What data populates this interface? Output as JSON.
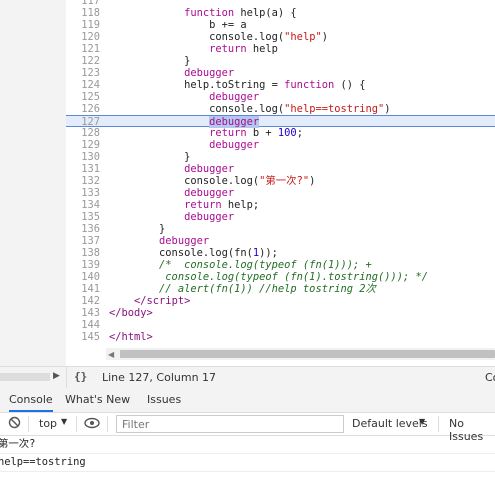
{
  "editor": {
    "lines": [
      {
        "n": "117",
        "h": ""
      },
      {
        "n": "118",
        "h": "            <span class=\"kw\">function</span> help(a) {"
      },
      {
        "n": "119",
        "h": "                b += a"
      },
      {
        "n": "120",
        "h": "                console.log(<span class=\"str\">\"help\"</span>)"
      },
      {
        "n": "121",
        "h": "                <span class=\"kw\">return</span> help"
      },
      {
        "n": "122",
        "h": "            }"
      },
      {
        "n": "123",
        "h": "            <span class=\"kw\">debugger</span>"
      },
      {
        "n": "124",
        "h": "            help.toString = <span class=\"kw\">function</span> () {"
      },
      {
        "n": "125",
        "h": "                <span class=\"kw\">debugger</span>"
      },
      {
        "n": "126",
        "h": "                console.log(<span class=\"str\">\"help==tostring\"</span>)"
      },
      {
        "n": "127",
        "h": "                <span class=\"kw sel\">debugger</span>",
        "active": true
      },
      {
        "n": "128",
        "h": "                <span class=\"kw\">return</span> b + <span class=\"num\">100</span>;"
      },
      {
        "n": "129",
        "h": "                <span class=\"kw\">debugger</span>"
      },
      {
        "n": "130",
        "h": "            }"
      },
      {
        "n": "131",
        "h": "            <span class=\"kw\">debugger</span>"
      },
      {
        "n": "132",
        "h": "            console.log(<span class=\"str\">\"第一次?\"</span>)"
      },
      {
        "n": "133",
        "h": "            <span class=\"kw\">debugger</span>"
      },
      {
        "n": "134",
        "h": "            <span class=\"kw\">return</span> help;"
      },
      {
        "n": "135",
        "h": "            <span class=\"kw\">debugger</span>"
      },
      {
        "n": "136",
        "h": "        }"
      },
      {
        "n": "137",
        "h": "        <span class=\"kw\">debugger</span>"
      },
      {
        "n": "138",
        "h": "        console.log(fn(<span class=\"num\">1</span>));"
      },
      {
        "n": "139",
        "h": "        <span class=\"cm\">/*  console.log(typeof (fn(1))); +</span>"
      },
      {
        "n": "140",
        "h": "<span class=\"cm\">         console.log(typeof (fn(1).tostring())); */</span>"
      },
      {
        "n": "141",
        "h": "        <span class=\"cm\">// alert(fn(1)) //help tostring 2次</span>"
      },
      {
        "n": "142",
        "h": "    <span class=\"tag\">&lt;/script&gt;</span>"
      },
      {
        "n": "143",
        "h": "<span class=\"tag\">&lt;/body&gt;</span>"
      },
      {
        "n": "144",
        "h": ""
      },
      {
        "n": "145",
        "h": "<span class=\"tag\">&lt;/html&gt;</span>"
      }
    ]
  },
  "status": {
    "brace": "{}",
    "cursor": "Line 127, Column 17",
    "truncated": "Co"
  },
  "tabs": {
    "console": "Console",
    "whats_new": "What's New",
    "issues": "Issues"
  },
  "toolbar": {
    "context": "top",
    "filter_placeholder": "Filter",
    "levels": "Default levels",
    "issues": "No Issues"
  },
  "console": {
    "lines": [
      "第一次?",
      "help==tostring"
    ]
  },
  "icons": {
    "clear": "clear-console-icon",
    "eye": "live-expression-eye-icon",
    "settings": "gear-icon"
  }
}
